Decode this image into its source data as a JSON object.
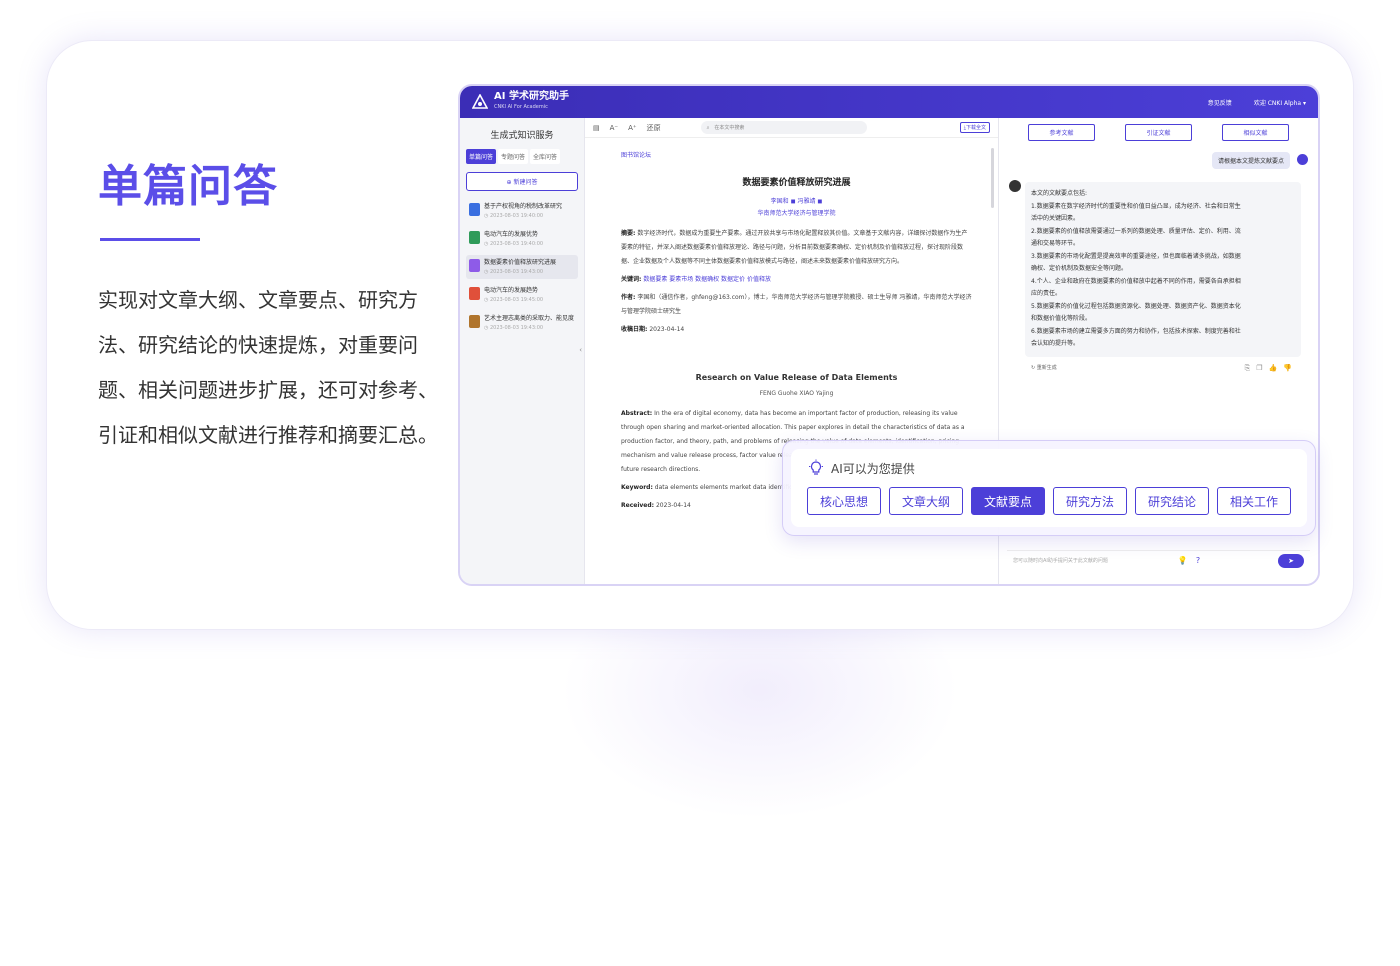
{
  "hero": {
    "title": "单篇问答",
    "description": "实现对文章大纲、文章要点、研究方法、研究结论的快速提炼，对重要问题、相关问题进步扩展，还可对参考、引证和相似文献进行推荐和摘要汇总。"
  },
  "app": {
    "brand_title": "AI 学术研究助手",
    "brand_sub": "CNKI AI For Academic",
    "feedback": "意见反馈",
    "user": "欢迎 CNKI Alpha ▾",
    "colors": {
      "accent": "#4c3fd8",
      "topbar": "#3b2db6"
    }
  },
  "left": {
    "title": "生成式知识服务",
    "tabs": [
      "单篇问答",
      "专题问答",
      "全库问答"
    ],
    "new_chat": "新建问答",
    "history": [
      {
        "name": "基于产权视角的税制改革研究",
        "date": "2023-08-03 19:40:00",
        "color": "#3a6fe0",
        "icon": "doc-icon"
      },
      {
        "name": "电动汽车的发展优势",
        "date": "2023-08-03 19:40:00",
        "color": "#2f9b5a",
        "icon": "excel-icon"
      },
      {
        "name": "数据要素价值释放研究进展",
        "date": "2023-08-03 19:43:00",
        "color": "#8e5be8",
        "icon": "doc-icon"
      },
      {
        "name": "电动汽车的发展趋势",
        "date": "2023-08-03 19:45:00",
        "color": "#e0503a",
        "icon": "ppt-icon"
      },
      {
        "name": "艺术主理志离类的采取力、能见度",
        "date": "2023-08-03 19:43:00",
        "color": "#b0752d",
        "icon": "file-icon"
      }
    ]
  },
  "mid": {
    "toolbar_a": "A⁻",
    "toolbar_b": "A⁺",
    "toolbar_back": "还原",
    "search_placeholder": "在本文中搜索",
    "download": "下载全文",
    "journal": "图书馆论坛",
    "title": "数据要素价值释放研究进展",
    "authors": "李国和 ◼    冯雅靖 ◼",
    "affil": "华南师范大学经济与管理学院",
    "abstract_label": "摘要:",
    "abstract": "数字经济时代，数据成为重要生产要素。通过开放共享与市场化配置释放其价值。文章基于文献内容，详细探讨数据作为生产要素的特征，并深入阐述数据要素价值释放理论、路径与问题，分析目前数据要素确权、定价机制及价值释放过程，探讨现阶段数据、企业数据及个人数据等不同主体数据要素价值释放模式与路径，阐述未来数据要素价值释放研究方向。",
    "keywords_label": "关键词:",
    "keywords": "数据要素  要素市场  数据确权  数据定价  价值释放",
    "author_label": "作者:",
    "author_info": "李国和（通信作者，ghfeng@163.com），博士，华南师范大学经济与管理学院教授、硕士生导师  冯雅靖，华南师范大学经济与管理学院硕士研究生",
    "received_label": "收稿日期:",
    "received": "2023-04-14",
    "en_title": "Research on Value Release of Data Elements",
    "en_authors": "FENG Guohe     XIAO Yajing",
    "en_abstract_label": "Abstract:",
    "en_abstract": "In the era of digital economy, data has become an important factor of production, releasing its value through open sharing and market-oriented allocation. This paper explores in detail the characteristics of data as a production factor, and theory, path, and problems of releasing the value of data elements, identification, pricing mechanism and value release process, factor value release for different subjects such as data, and points out the future research directions.",
    "en_keyword_label": "Keyword:",
    "en_keywords": "data elements  elements market  data identification  data pricing  value unlocking",
    "en_received_label": "Received:",
    "en_received": "2023-04-14"
  },
  "right": {
    "ref_tabs": [
      "参考文献",
      "引证文献",
      "相似文献"
    ],
    "user_msg": "请根据本文提炼文献要点",
    "answer": [
      "本文的文献要点包括:",
      "1.数据要素在数字经济时代的重要性和价值日益凸显，成为经济、社会和日常生",
      "活中的关键因素。",
      "2.数据要素的价值释放需要通过一系列的数据处理、质量评估、定价、利用、流",
      "通和交易等环节。",
      "3.数据要素的市场化配置是提高效率的重要途径，但也面临着诸多挑战，如数据",
      "确权、定价机制及数据安全等问题。",
      "4.个人、企业和政府在数据要素的价值释放中起着不同的作用，需要各自承担相",
      "应的责任。",
      "5.数据要素的价值化过程包括数据资源化、数据处理、数据资产化、数据资本化",
      "和数据价值化等阶段。",
      "6.数据要素市场的建立需要多方面的努力和协作，包括技术探索、制度完善和社",
      "会认知的提升等。"
    ],
    "regen": "重新生成",
    "input_placeholder": "您可以随时向AI助手提问关于此文献的问题",
    "send": "➤"
  },
  "popup": {
    "heading": "AI可以为您提供",
    "chips": [
      "核心思想",
      "文章大纲",
      "文献要点",
      "研究方法",
      "研究结论",
      "相关工作"
    ],
    "active_index": 2
  }
}
